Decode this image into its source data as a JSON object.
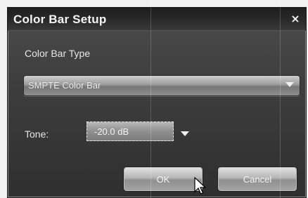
{
  "dialog": {
    "title": "Color Bar Setup",
    "close_glyph": "×",
    "color_bar_type_label": "Color Bar Type",
    "color_bar_type_value": "SMPTE Color Bar",
    "tone_label": "Tone:",
    "tone_value": "-20.0 dB",
    "ok_label": "OK",
    "cancel_label": "Cancel"
  },
  "icons": {
    "close": "close-icon",
    "dropdown": "chevron-down-icon",
    "pointer": "mouse-pointer-icon"
  },
  "colors": {
    "dialog_bg": "#3e3e3e",
    "titlebar_bg": "#2b2b2b",
    "text": "#f0f0f0"
  }
}
